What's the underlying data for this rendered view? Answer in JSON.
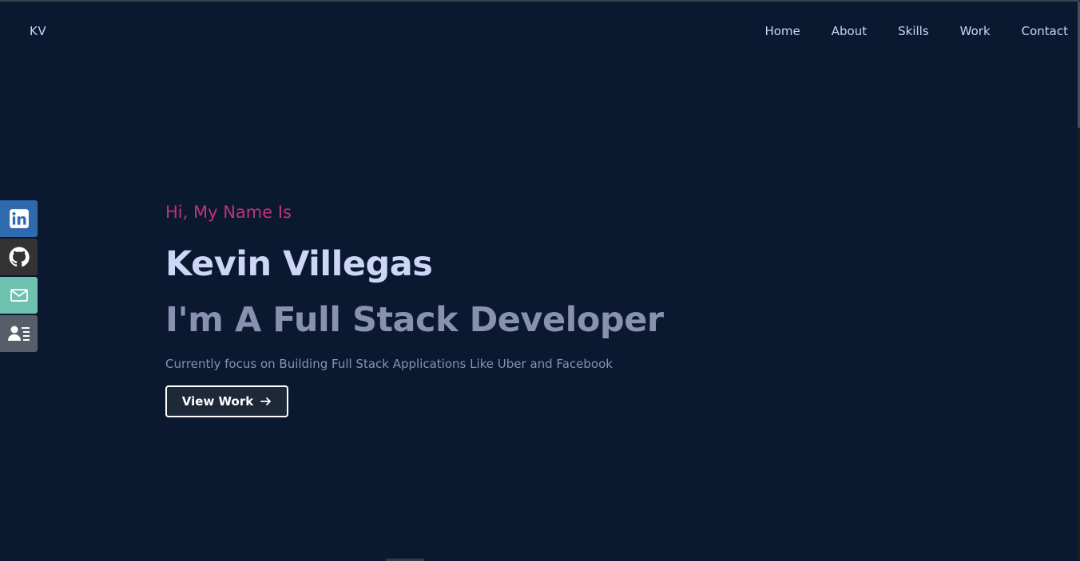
{
  "nav": {
    "logo": "KV",
    "items": [
      {
        "label": "Home"
      },
      {
        "label": "About"
      },
      {
        "label": "Skills"
      },
      {
        "label": "Work"
      },
      {
        "label": "Contact"
      }
    ]
  },
  "social": [
    {
      "icon": "linkedin-icon",
      "color": "#2f6aaf"
    },
    {
      "icon": "github-icon",
      "color": "#333333"
    },
    {
      "icon": "mail-icon",
      "color": "#6fc2b0"
    },
    {
      "icon": "resume-icon",
      "color": "#565f69"
    }
  ],
  "hero": {
    "greeting": "Hi, My Name Is",
    "name": "Kevin Villegas",
    "role": "I'm A Full Stack Developer",
    "tagline": "Currently focus on Building Full Stack Applications Like Uber and Facebook",
    "button_label": "View Work",
    "button_icon": "arrow-right-icon"
  },
  "colors": {
    "background": "#0a192f",
    "accent": "#c3317d",
    "primary_text": "#ccd6f6",
    "secondary_text": "#8892b0"
  }
}
